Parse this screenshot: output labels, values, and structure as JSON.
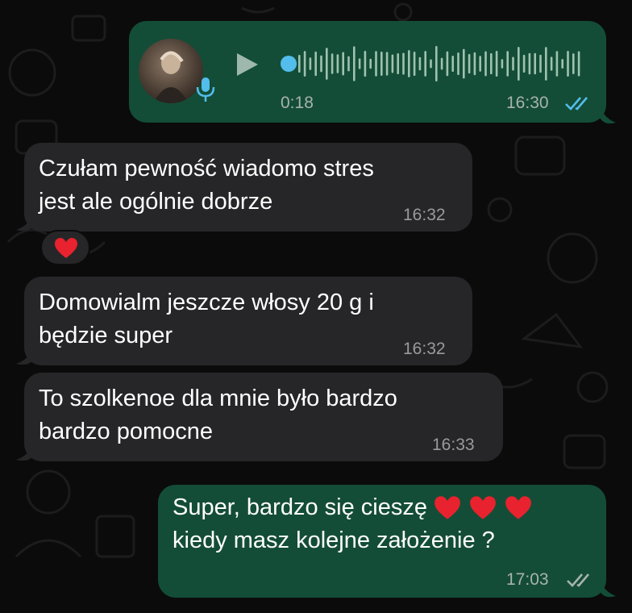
{
  "colors": {
    "outgoing_bubble": "#144d37",
    "incoming_bubble": "#262628",
    "read_ticks": "#53bdeb",
    "delivered_ticks": "#a7b3ad",
    "heart": "#e8222e"
  },
  "voice_message": {
    "duration": "0:18",
    "time": "16:30",
    "status": "read",
    "icons": [
      "avatar",
      "mic-icon",
      "play-icon",
      "waveform"
    ]
  },
  "messages": [
    {
      "direction": "in",
      "text": "Czułam pewność wiadomo stres\njest ale ogólnie dobrze",
      "time": "16:32",
      "reaction": "❤️"
    },
    {
      "direction": "in",
      "text": "Domowialm jeszcze włosy 20 g i\nbędzie super",
      "time": "16:32"
    },
    {
      "direction": "in",
      "text": "To szolkenoe dla mnie było bardzo\nbardzo pomocne",
      "time": "16:33"
    },
    {
      "direction": "out",
      "text_line1": "Super, bardzo się cieszę",
      "text_line2": "kiedy masz kolejne założenie ?",
      "emoji": "❤️❤️❤️",
      "time": "17:03",
      "status": "delivered"
    }
  ]
}
